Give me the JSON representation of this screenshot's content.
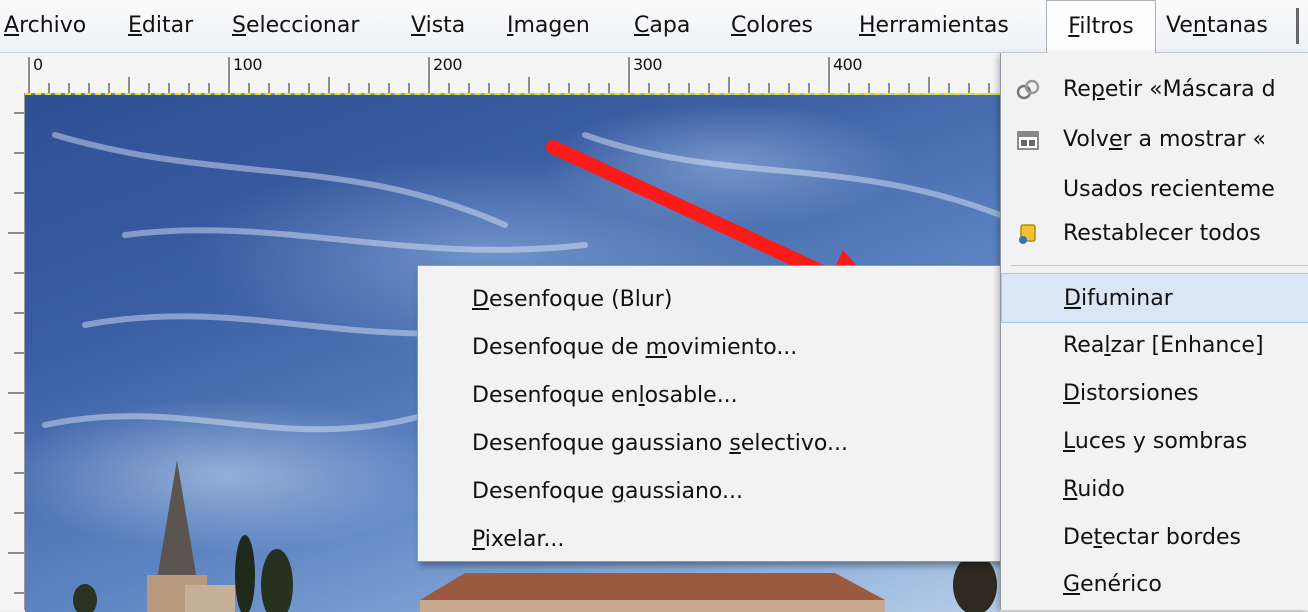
{
  "menubar": {
    "items": [
      {
        "pre": "",
        "u": "A",
        "post": "rchivo"
      },
      {
        "pre": "",
        "u": "E",
        "post": "ditar"
      },
      {
        "pre": "",
        "u": "S",
        "post": "eleccionar"
      },
      {
        "pre": "",
        "u": "V",
        "post": "ista"
      },
      {
        "pre": "",
        "u": "I",
        "post": "magen"
      },
      {
        "pre": "",
        "u": "C",
        "post": "apa"
      },
      {
        "pre": "",
        "u": "C",
        "post": "olores"
      },
      {
        "pre": "",
        "u": "H",
        "post": "erramientas"
      },
      {
        "pre": "",
        "u": "F",
        "post": "iltros"
      },
      {
        "pre": "Ve",
        "u": "n",
        "post": "tanas"
      }
    ]
  },
  "ruler": {
    "labels": [
      "0",
      "100",
      "200",
      "300",
      "400"
    ]
  },
  "filters_menu": {
    "items": [
      {
        "pre": "Re",
        "u": "p",
        "post": "etir «Máscara d",
        "icon": "repeat-icon"
      },
      {
        "pre": "Volv",
        "u": "e",
        "post": "r a mostrar «",
        "icon": "reshow-icon"
      },
      {
        "pre": "Usados recienteme",
        "u": "",
        "post": "",
        "icon": ""
      },
      {
        "pre": "Restablecer todos",
        "u": "",
        "post": "",
        "icon": "reset-icon"
      },
      {
        "pre": "",
        "u": "D",
        "post": "ifuminar",
        "icon": ""
      },
      {
        "pre": "Rea",
        "u": "l",
        "post": "zar [Enhance]",
        "icon": ""
      },
      {
        "pre": "",
        "u": "D",
        "post": "istorsiones",
        "icon": ""
      },
      {
        "pre": "",
        "u": "L",
        "post": "uces y sombras",
        "icon": ""
      },
      {
        "pre": "",
        "u": "R",
        "post": "uido",
        "icon": ""
      },
      {
        "pre": "De",
        "u": "t",
        "post": "ectar bordes",
        "icon": ""
      },
      {
        "pre": "",
        "u": "G",
        "post": "enérico",
        "icon": ""
      }
    ]
  },
  "blur_submenu": {
    "items": [
      {
        "pre": "",
        "u": "D",
        "post": "esenfoque (Blur)"
      },
      {
        "pre": "Desenfoque de ",
        "u": "m",
        "post": "ovimiento..."
      },
      {
        "pre": "Desenfoque en",
        "u": "l",
        "post": "osable..."
      },
      {
        "pre": "Desenfoque gaussiano ",
        "u": "s",
        "post": "electivo..."
      },
      {
        "pre": "Desenfoque ",
        "u": "g",
        "post": "aussiano..."
      },
      {
        "pre": "",
        "u": "P",
        "post": "ixelar..."
      }
    ]
  },
  "colors": {
    "arrow": "#ff1a1a",
    "menu_highlight": "#dbe6f4"
  }
}
